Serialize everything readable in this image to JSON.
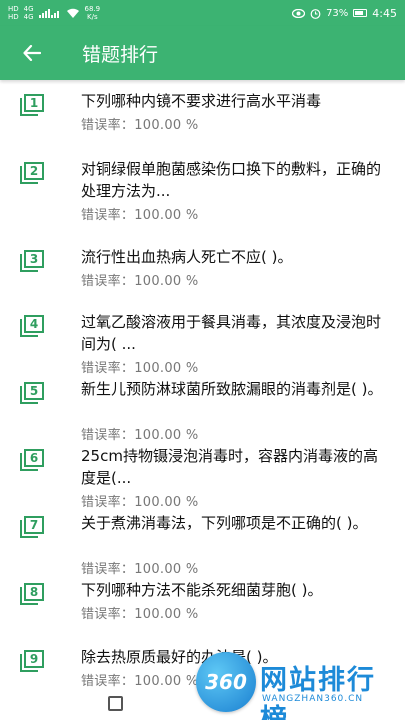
{
  "status_bar": {
    "sim1": "HD",
    "sim1_net": "4G",
    "sim2": "HD",
    "sim2_net": "4G",
    "speed_value": "68.9",
    "speed_unit": "K/s",
    "battery": "73%",
    "time": "4:45",
    "icons": [
      "wifi-icon",
      "eye-icon",
      "alarm-icon",
      "battery-icon"
    ]
  },
  "app_bar": {
    "title": "错题排行",
    "back_icon": "arrow-left-icon"
  },
  "rate_prefix": "错误率：",
  "questions": [
    {
      "num": "1",
      "text": "下列哪种内镜不要求进行高水平消毒",
      "rate": "错误率：100.00 %"
    },
    {
      "num": "2",
      "text": "对铜绿假单胞菌感染伤口换下的敷料，正确的处理方法为...",
      "rate": "错误率：100.00 %"
    },
    {
      "num": "3",
      "text": "流行性出血热病人死亡不应(  )。",
      "rate": "错误率：100.00 %"
    },
    {
      "num": "4",
      "text": "过氧乙酸溶液用于餐具消毒，其浓度及浸泡时间为(  ...",
      "rate": "错误率：100.00 %"
    },
    {
      "num": "5",
      "text": "新生儿预防淋球菌所致脓漏眼的消毒剂是(  )。",
      "rate": "错误率：100.00 %"
    },
    {
      "num": "6",
      "text": "25cm持物镊浸泡消毒时，容器内消毒液的高度是(...",
      "rate": "错误率：100.00 %"
    },
    {
      "num": "7",
      "text": "关于煮沸消毒法，下列哪项是不正确的(  )。",
      "rate": "错误率：100.00 %"
    },
    {
      "num": "8",
      "text": "下列哪种方法不能杀死细菌芽胞(  )。",
      "rate": "错误率：100.00 %"
    },
    {
      "num": "9",
      "text": "除去热原质最好的办法是(  )。",
      "rate": "错误率：100.00 %"
    }
  ],
  "watermark": {
    "badge": "360",
    "title": "网站排行榜",
    "subtitle": "WANGZHAN360.CN"
  },
  "colors": {
    "primary": "#3cb372",
    "icon_green": "#2f9e5f",
    "text": "#111111",
    "subtext": "#777777"
  }
}
